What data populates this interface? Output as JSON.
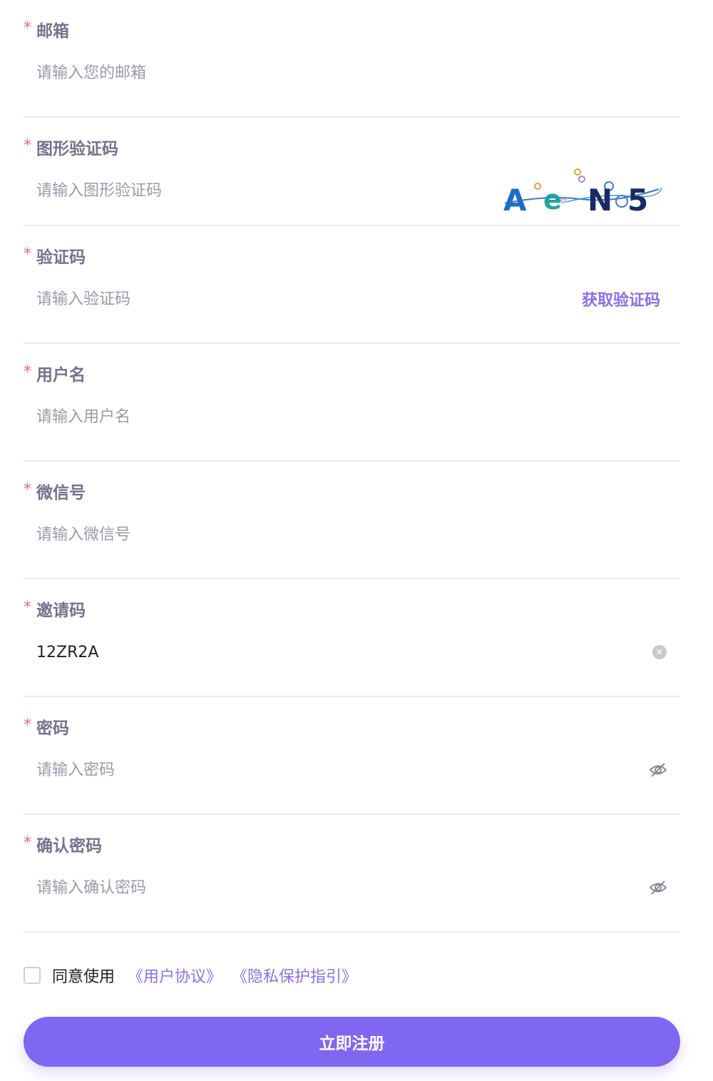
{
  "fields": [
    {
      "label": "邮箱",
      "placeholder": "请输入您的邮箱",
      "value": ""
    },
    {
      "label": "图形验证码",
      "placeholder": "请输入图形验证码",
      "value": ""
    },
    {
      "label": "验证码",
      "placeholder": "请输入验证码",
      "value": "",
      "action": "获取验证码"
    },
    {
      "label": "用户名",
      "placeholder": "请输入用户名",
      "value": ""
    },
    {
      "label": "微信号",
      "placeholder": "请输入微信号",
      "value": ""
    },
    {
      "label": "邀请码",
      "placeholder": "",
      "value": "12ZR2A"
    },
    {
      "label": "密码",
      "placeholder": "请输入密码",
      "value": ""
    },
    {
      "label": "确认密码",
      "placeholder": "请输入确认密码",
      "value": ""
    }
  ],
  "required_mark": "*",
  "captcha": {
    "text": "AeN5",
    "chars": [
      "A",
      "e",
      "N",
      "5"
    ]
  },
  "agreement": {
    "text": "同意使用",
    "user_agreement": "《用户协议》",
    "privacy_guide": "《隐私保护指引》",
    "checked": false
  },
  "submit_label": "立即注册",
  "colors": {
    "accent": "#7f67f2",
    "link": "#8a6ff0",
    "required": "#ee6b6b",
    "label": "#73738e"
  }
}
